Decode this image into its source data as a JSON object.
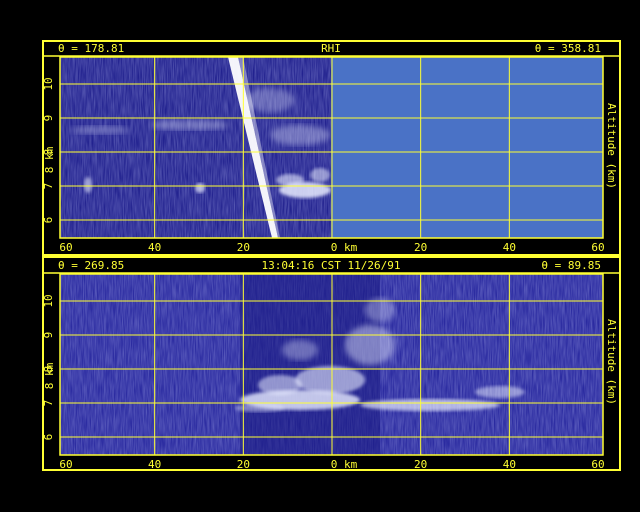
{
  "colors": {
    "background": "#000000",
    "frame": "#ffff33",
    "echo_field": "#22228f",
    "masked_area": "#4a72c6",
    "cloud": "#e8ecff"
  },
  "top_panel": {
    "left_angle": "θ = 178.81",
    "center_label": "RHI",
    "right_angle": "θ = 358.81",
    "y_axis_label": "8 km",
    "right_axis_label": "Altitude (km)",
    "masked_half": "right",
    "beam_artifact": true
  },
  "bottom_panel": {
    "left_angle": "θ = 269.85",
    "center_label": "13:04:16 CST 11/26/91",
    "right_angle": "θ = 89.85",
    "y_axis_label": "8 km",
    "right_axis_label": "Altitude (km)"
  },
  "axes": {
    "x_ticks": [
      "60",
      "40",
      "20",
      "0 km",
      "20",
      "40",
      "60"
    ],
    "y_ticks": [
      "6",
      "7",
      "8",
      "9",
      "10"
    ]
  }
}
